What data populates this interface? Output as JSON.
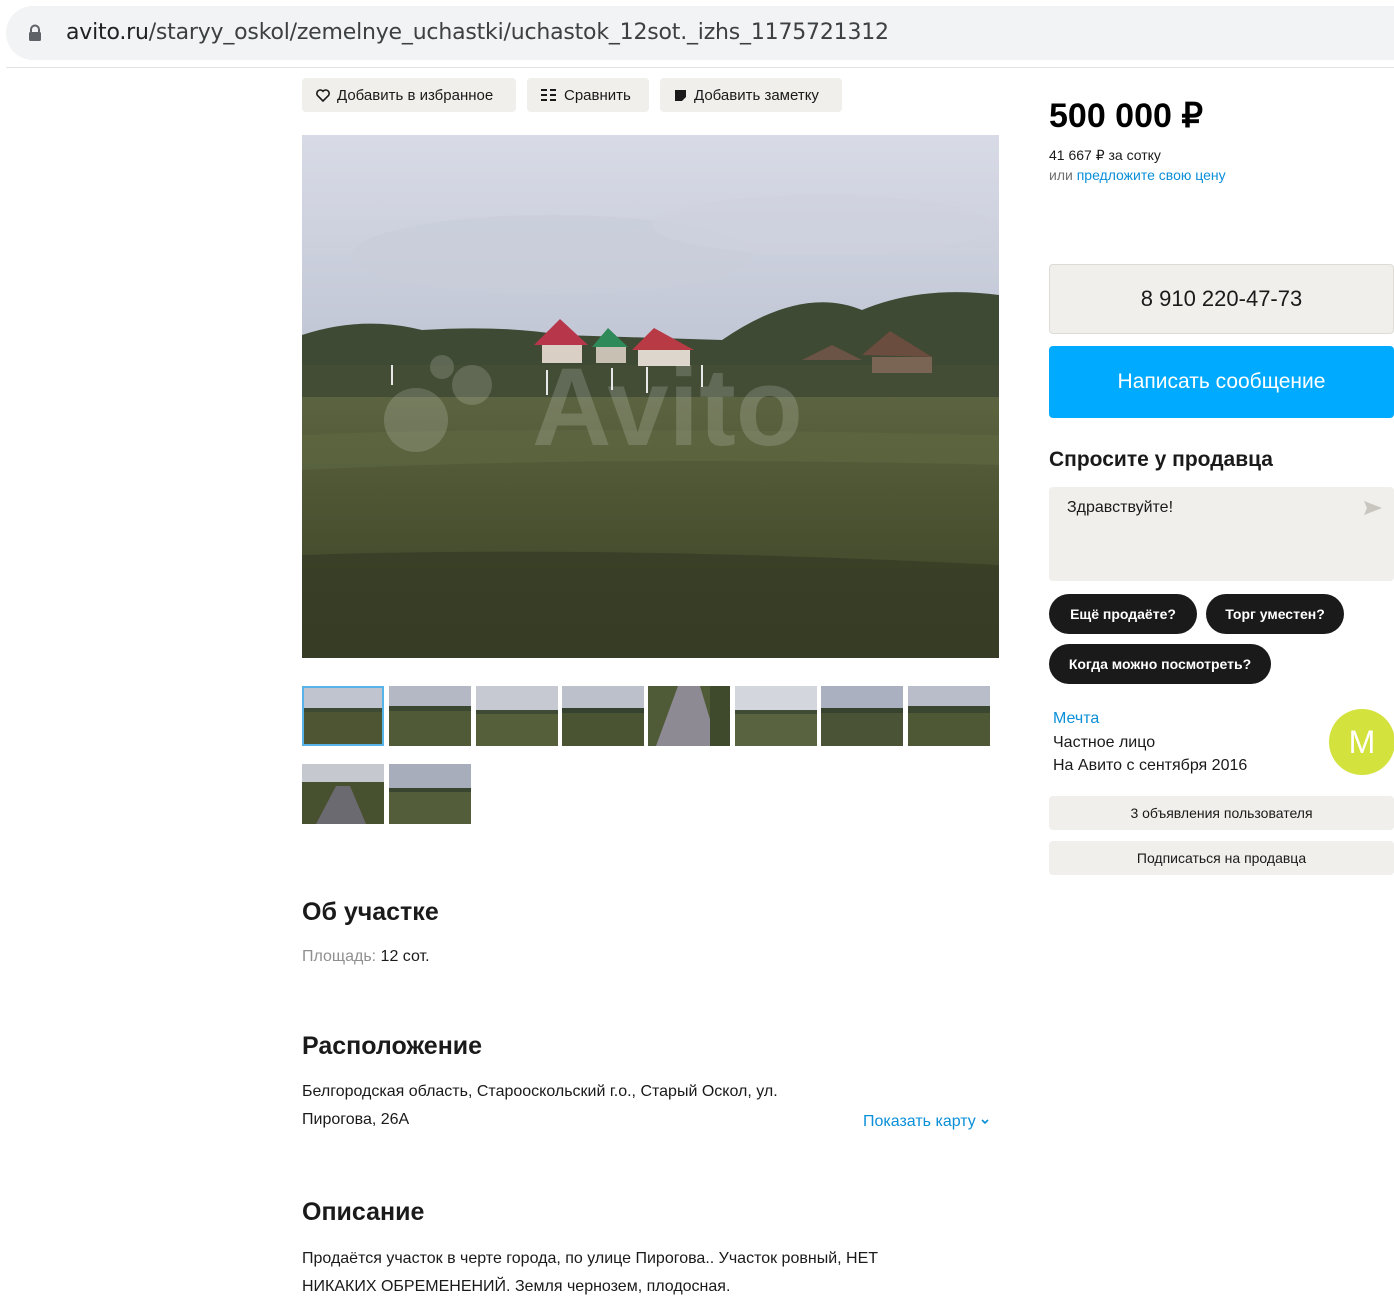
{
  "browser": {
    "url_host": "avito.ru",
    "url_path": "/staryy_oskol/zemelnye_uchastki/uchastok_12sot._izhs_1175721312"
  },
  "actions": {
    "favorite": "Добавить в избранное",
    "compare": "Сравнить",
    "note": "Добавить заметку"
  },
  "gallery": {
    "watermark": "Avito",
    "thumbnail_count": 10
  },
  "about": {
    "title": "Об участке",
    "area_label": "Площадь:",
    "area_value": "12 сот."
  },
  "location": {
    "title": "Расположение",
    "address_line1": "Белгородская область, Старооскольский г.о., Старый Оскол, ул.",
    "address_line2": "Пирогова, 26А",
    "show_map": "Показать карту"
  },
  "description": {
    "title": "Описание",
    "line1": "Продаётся участок в черте города, по улице Пирогова.. Участок ровный, НЕТ",
    "line2": "НИКАКИХ ОБРЕМЕНЕНИЙ. Земля чернозем, плодосная."
  },
  "sidebar": {
    "price": "500 000 ₽",
    "per_unit": "41 667 ₽ за сотку",
    "offer_prefix": "или",
    "offer_link": "предложите свою цену",
    "phone": "8 910 220-47-73",
    "write_message": "Написать сообщение",
    "ask_title": "Спросите у продавца",
    "ask_value": "Здравствуйте!",
    "chips": [
      "Ещё продаёте?",
      "Торг уместен?",
      "Когда можно посмотреть?"
    ],
    "seller_name": "Мечта",
    "seller_type": "Частное лицо",
    "seller_since": "На Авито с сентября 2016",
    "avatar_letter": "M",
    "listings_button": "3 объявления пользователя",
    "subscribe_button": "Подписаться на продавца"
  },
  "colors": {
    "accent": "#00aaff",
    "link": "#0a8fd8",
    "avatar": "#d4e23e",
    "chip": "#1a1a1a",
    "button_bg": "#f0efeb"
  }
}
